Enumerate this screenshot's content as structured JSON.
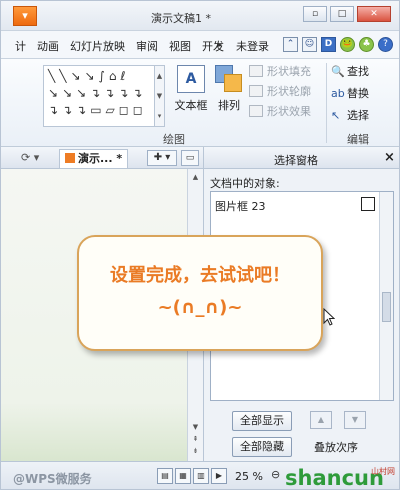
{
  "window": {
    "app_button": "▾",
    "title": "演示文稿1 *",
    "controls": [
      "▫",
      "□",
      "✕"
    ]
  },
  "menu": {
    "tabs": [
      "计",
      "动画",
      "幻灯片放映",
      "审阅",
      "视图",
      "开发"
    ],
    "more": "▸",
    "login": "未登录",
    "icons": [
      "⌃",
      "☺",
      "D",
      "🐸",
      "♣",
      "?"
    ]
  },
  "ribbon": {
    "shape_rows": [
      [
        "╲",
        "╲",
        "↘",
        "↘",
        "∫",
        "⌂",
        "ℓ"
      ],
      [
        "↘",
        "↘",
        "↘",
        "↴",
        "↴",
        "↴",
        "↴"
      ],
      [
        "↴",
        "↴",
        "↴",
        "▭",
        "▱",
        "◻",
        "◻"
      ]
    ],
    "textbox_label": "文本框",
    "arrange_label": "排列",
    "format_items": [
      "形状填充",
      "形状轮廓",
      "形状效果"
    ],
    "edit_items": [
      "查找",
      "替换",
      "选择"
    ],
    "group_draw": "绘图",
    "group_edit": "编辑"
  },
  "doc": {
    "tab_label": "演示... *",
    "tab_add": "✚ ▾",
    "tab_list": "▭"
  },
  "pane": {
    "title": "选择窗格",
    "close": "×",
    "subtitle": "文档中的对象:",
    "objects": [
      {
        "name": "图片框 23",
        "visible": false
      }
    ],
    "show_all": "全部显示",
    "hide_all": "全部隐藏",
    "order_label": "叠放次序",
    "up": "▲",
    "down": "▼"
  },
  "callout": {
    "line1": "设置完成，去试试吧！",
    "line2": "~(∩_∩)~"
  },
  "status": {
    "watermark_left": "@WPS微服务",
    "zoom": "25 %",
    "zoom_minus": "⊖",
    "watermark_right": "shancun",
    "watermark_small": "山村网"
  }
}
